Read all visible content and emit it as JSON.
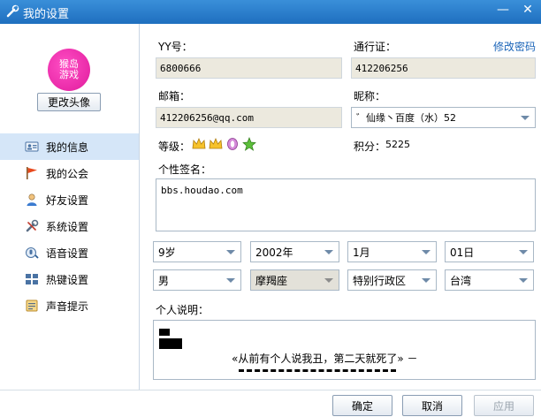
{
  "window": {
    "title": "我的设置",
    "minimize": "—",
    "close": "✕"
  },
  "profile": {
    "avatar_text": [
      "猴岛",
      "游戏"
    ],
    "change_avatar_label": "更改头像"
  },
  "nav": {
    "items": [
      {
        "label": "我的信息",
        "icon": "id-card-icon",
        "selected": true
      },
      {
        "label": "我的公会",
        "icon": "flag-icon",
        "selected": false
      },
      {
        "label": "好友设置",
        "icon": "friends-icon",
        "selected": false
      },
      {
        "label": "系统设置",
        "icon": "tools-icon",
        "selected": false
      },
      {
        "label": "语音设置",
        "icon": "voice-icon",
        "selected": false
      },
      {
        "label": "热键设置",
        "icon": "hotkey-icon",
        "selected": false
      },
      {
        "label": "声音提示",
        "icon": "sound-icon",
        "selected": false
      }
    ]
  },
  "form": {
    "yy_label": "YY号：",
    "yy_value": "6800666",
    "passport_label": "通行证：",
    "passport_value": "412206256",
    "change_password": "修改密码",
    "email_label": "邮箱：",
    "email_value": "412206256@qq.com",
    "nickname_label": "昵称：",
    "nickname_value": "゛仙缘丶百度（水）52",
    "level_label": "等级：",
    "points_label": "积分：",
    "points_value": "5225",
    "signature_label": "个性签名：",
    "signature_value": "bbs.houdao.com",
    "age": "9岁",
    "year": "2002年",
    "month": "1月",
    "day": "01日",
    "gender": "男",
    "zodiac": "摩羯座",
    "region": "特别行政区",
    "city": "台湾",
    "bio_label": "个人说明：",
    "bio_text": "«从前有个人说我丑，第二天就死了» －"
  },
  "buttons": {
    "ok": "确定",
    "cancel": "取消",
    "apply": "应用"
  },
  "colors": {
    "titlebar": "#2a7fd0",
    "selected_nav": "#d5e6f8",
    "readonly_field": "#ece9de",
    "link": "#1a64b8"
  }
}
